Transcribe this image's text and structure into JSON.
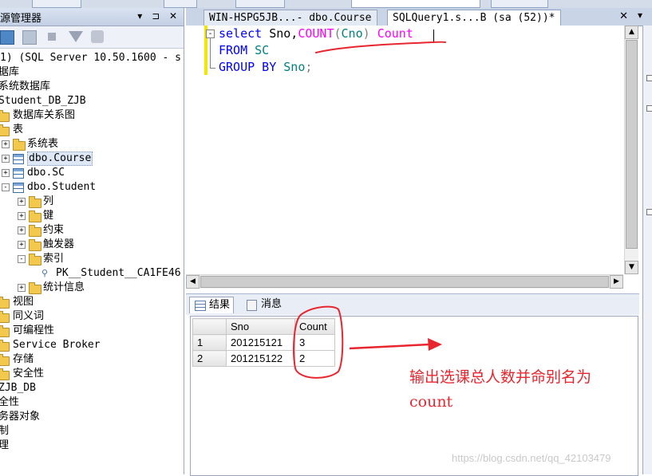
{
  "object_explorer": {
    "title": "源管理器",
    "title_buttons": "▾ ⊐ ✕",
    "tree": [
      {
        "text": "1) (SQL Server 10.50.1600 - s",
        "level": 0,
        "icon": "server-icon",
        "expander": ""
      },
      {
        "text": "据库",
        "level": 0,
        "icon": "none",
        "expander": ""
      },
      {
        "text": "系统数据库",
        "level": 0,
        "icon": "none",
        "expander": ""
      },
      {
        "text": "Student_DB_ZJB",
        "level": 0,
        "icon": "none",
        "expander": ""
      },
      {
        "text": "数据库关系图",
        "level": 0,
        "icon": "folder-icon",
        "expander": ""
      },
      {
        "text": "表",
        "level": 0,
        "icon": "folder-icon",
        "expander": ""
      },
      {
        "text": "系统表",
        "level": 1,
        "icon": "folder-icon",
        "expander": "+"
      },
      {
        "text": "dbo.Course",
        "level": 1,
        "icon": "table-icon",
        "expander": "+",
        "highlight": true
      },
      {
        "text": "dbo.SC",
        "level": 1,
        "icon": "table-icon",
        "expander": "+"
      },
      {
        "text": "dbo.Student",
        "level": 1,
        "icon": "table-icon",
        "expander": "-"
      },
      {
        "text": "列",
        "level": 2,
        "icon": "folder-icon",
        "expander": "+"
      },
      {
        "text": "键",
        "level": 2,
        "icon": "folder-icon",
        "expander": "+"
      },
      {
        "text": "约束",
        "level": 2,
        "icon": "folder-icon",
        "expander": "+"
      },
      {
        "text": "触发器",
        "level": 2,
        "icon": "folder-icon",
        "expander": "+"
      },
      {
        "text": "索引",
        "level": 2,
        "icon": "folder-icon",
        "expander": "-"
      },
      {
        "text": "PK__Student__CA1FE46",
        "level": 3,
        "icon": "index-icon",
        "expander": ""
      },
      {
        "text": "统计信息",
        "level": 2,
        "icon": "folder-icon",
        "expander": "+"
      },
      {
        "text": "视图",
        "level": 0,
        "icon": "folder-icon",
        "expander": ""
      },
      {
        "text": "同义词",
        "level": 0,
        "icon": "folder-icon",
        "expander": ""
      },
      {
        "text": "可编程性",
        "level": 0,
        "icon": "folder-icon",
        "expander": ""
      },
      {
        "text": "Service Broker",
        "level": 0,
        "icon": "folder-icon",
        "expander": ""
      },
      {
        "text": "存储",
        "level": 0,
        "icon": "folder-icon",
        "expander": ""
      },
      {
        "text": "安全性",
        "level": 0,
        "icon": "folder-icon",
        "expander": ""
      },
      {
        "text": "ZJB_DB",
        "level": 0,
        "icon": "none",
        "expander": ""
      },
      {
        "text": "全性",
        "level": 0,
        "icon": "none",
        "expander": ""
      },
      {
        "text": "务器对象",
        "level": 0,
        "icon": "none",
        "expander": ""
      },
      {
        "text": "制",
        "level": 0,
        "icon": "none",
        "expander": ""
      },
      {
        "text": "理",
        "level": 0,
        "icon": "none",
        "expander": ""
      }
    ]
  },
  "doc_tabs": {
    "tab1": "WIN-HSPG5JB...- dbo.Course",
    "tab2": "SQLQuery1.s...B (sa (52))*",
    "close": "✕",
    "scroll": "▾"
  },
  "query": {
    "line1": {
      "kw": "select",
      "cols": "Sno,",
      "fn": "COUNT",
      "open": "(",
      "arg": "Cno",
      "close": ")",
      "alias": "Count"
    },
    "line2": {
      "kw": "FROM",
      "table": "SC"
    },
    "line3": {
      "kw": "GROUP BY",
      "col": "Sno",
      "end": ";"
    },
    "fold": "-"
  },
  "results_tabs": {
    "results": "结果",
    "messages": "消息"
  },
  "grid": {
    "headers": [
      "Sno",
      "Count"
    ],
    "rows": [
      {
        "n": "1",
        "sno": "201215121",
        "count": "3"
      },
      {
        "n": "2",
        "sno": "201215122",
        "count": "2"
      }
    ]
  },
  "annotation": {
    "text_line1": "输出选课总人数并命别名为",
    "text_line2": "count",
    "color": "#e8262f"
  },
  "watermark": "https://blog.csdn.net/qq_42103479",
  "scroll": {
    "up": "▲",
    "down": "▼",
    "left": "◀",
    "right": "▶"
  }
}
